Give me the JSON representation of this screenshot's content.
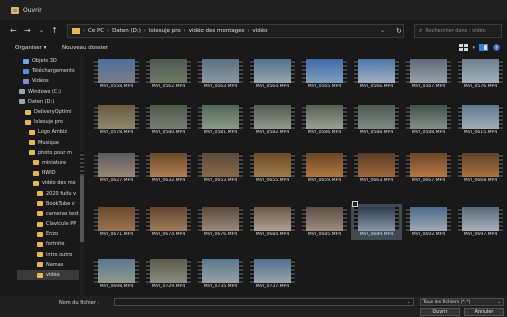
{
  "window": {
    "title": "Ouvrir"
  },
  "nav": {
    "back": "←",
    "forward": "→",
    "dropdown": "⌄",
    "up": "↑",
    "refresh": "↻"
  },
  "address": {
    "crumbs": [
      "Ce PC",
      "Daten (D:)",
      "lolesuje pro",
      "vidéo des montages",
      "vidéo"
    ]
  },
  "search": {
    "placeholder": "Rechercher dans : vidéo"
  },
  "commands": {
    "organize": "Organiser ▾",
    "new_folder": "Nouveau dossier"
  },
  "sidebar": {
    "items": [
      {
        "label": "Objets 3D",
        "icon": "cube-icon",
        "color": "#6aa9e6"
      },
      {
        "label": "Téléchargements",
        "icon": "download-icon",
        "color": "#4e8fe0"
      },
      {
        "label": "Vidéos",
        "icon": "video-icon",
        "color": "#8a8ad8"
      },
      {
        "label": "Windows (C:)",
        "icon": "drive-icon",
        "color": "#9aa6b2"
      },
      {
        "label": "Daten (D:)",
        "icon": "drive-icon",
        "color": "#9aa6b2"
      },
      {
        "label": "DeliveryOptimi",
        "icon": "folder-icon",
        "color": "#e8b84a"
      },
      {
        "label": "lolesuje pro",
        "icon": "folder-icon",
        "color": "#e8b84a"
      },
      {
        "label": "Logo Ambiz",
        "icon": "folder-icon",
        "color": "#e8b84a"
      },
      {
        "label": "Musique",
        "icon": "folder-icon",
        "color": "#e8b84a"
      },
      {
        "label": "photo pour m",
        "icon": "folder-icon",
        "color": "#e8b84a"
      },
      {
        "label": "miniature",
        "icon": "folder-icon",
        "color": "#e8b84a"
      },
      {
        "label": "RWID",
        "icon": "folder-icon",
        "color": "#e8b84a"
      },
      {
        "label": "vidéo des mo",
        "icon": "folder-icon",
        "color": "#e8b84a"
      },
      {
        "label": "2020 fuifu v",
        "icon": "folder-icon",
        "color": "#e8b84a"
      },
      {
        "label": "BookTube v",
        "icon": "folder-icon",
        "color": "#e8b84a"
      },
      {
        "label": "cameras test",
        "icon": "folder-icon",
        "color": "#e8b84a"
      },
      {
        "label": "Clavicule PP",
        "icon": "folder-icon",
        "color": "#e8b84a"
      },
      {
        "label": "Enzo",
        "icon": "folder-icon",
        "color": "#e8b84a"
      },
      {
        "label": "fortnite",
        "icon": "folder-icon",
        "color": "#e8b84a"
      },
      {
        "label": "intro outro",
        "icon": "folder-icon",
        "color": "#e8b84a"
      },
      {
        "label": "Namas",
        "icon": "folder-icon",
        "color": "#e8b84a"
      },
      {
        "label": "vidéo",
        "icon": "folder-icon",
        "color": "#e8b84a"
      }
    ]
  },
  "files": [
    {
      "name": "MVI_0558.MP4",
      "colors": [
        "#4a6f9a",
        "#7a7f86"
      ]
    },
    {
      "name": "MVI_0562.MP4",
      "colors": [
        "#4e5a52",
        "#6e7a62"
      ]
    },
    {
      "name": "MVI_0563.MP4",
      "colors": [
        "#5a6f82",
        "#8e99a0"
      ]
    },
    {
      "name": "MVI_0564.MP4",
      "colors": [
        "#54708e",
        "#9aa7ae"
      ]
    },
    {
      "name": "MVI_0565.MP4",
      "colors": [
        "#3f6aa5",
        "#80a0c0"
      ]
    },
    {
      "name": "MVI_0566.MP4",
      "colors": [
        "#4c78a8",
        "#a0b0c0"
      ]
    },
    {
      "name": "MVI_0567.MP4",
      "colors": [
        "#5c6a78",
        "#9aa2a8"
      ]
    },
    {
      "name": "MVI_0576.MP4",
      "colors": [
        "#6a7f92",
        "#a8b2ba"
      ]
    },
    {
      "name": "MVI_0578.MP4",
      "colors": [
        "#6a5a3a",
        "#8a8a70"
      ]
    },
    {
      "name": "MVI_0580.MP4",
      "colors": [
        "#4c5a48",
        "#7a7e76"
      ]
    },
    {
      "name": "MVI_0581.MP4",
      "colors": [
        "#4f6850",
        "#8c9a8a"
      ]
    },
    {
      "name": "MVI_0582.MP4",
      "colors": [
        "#4f5e4a",
        "#909a8e"
      ]
    },
    {
      "name": "MVI_0586.MP4",
      "colors": [
        "#55624e",
        "#9aa096"
      ]
    },
    {
      "name": "MVI_0588.MP4",
      "colors": [
        "#4a5c52",
        "#7e8a84"
      ]
    },
    {
      "name": "MVI_0588.MP4",
      "colors": [
        "#3e5248",
        "#86908a"
      ]
    },
    {
      "name": "MVI_0615.MP4",
      "colors": [
        "#5a7a90",
        "#a4aeb4"
      ]
    },
    {
      "name": "MVI_0627.MP4",
      "colors": [
        "#5a5a5e",
        "#9a8a76"
      ]
    },
    {
      "name": "MVI_0632.MP4",
      "colors": [
        "#6a4a2a",
        "#b08050"
      ]
    },
    {
      "name": "MVI_0653.MP4",
      "colors": [
        "#5a4a3a",
        "#8a6a48"
      ]
    },
    {
      "name": "MVI_0655.MP4",
      "colors": [
        "#6a4a2a",
        "#a07a4a"
      ]
    },
    {
      "name": "MVI_0659.MP4",
      "colors": [
        "#6a4424",
        "#b0783e"
      ]
    },
    {
      "name": "MVI_0663.MP4",
      "colors": [
        "#5a3a22",
        "#a06a3a"
      ]
    },
    {
      "name": "MVI_0667.MP4",
      "colors": [
        "#6a4526",
        "#b57a44"
      ]
    },
    {
      "name": "MVI_0668.MP4",
      "colors": [
        "#5c4226",
        "#a8743e"
      ]
    },
    {
      "name": "MVI_0671.MP4",
      "colors": [
        "#6a4a2e",
        "#9a7250"
      ]
    },
    {
      "name": "MVI_0674.MP4",
      "colors": [
        "#5e4632",
        "#a07c58"
      ]
    },
    {
      "name": "MVI_0676.MP4",
      "colors": [
        "#5a4a3e",
        "#9a8a76"
      ]
    },
    {
      "name": "MVI_0684.MP4",
      "colors": [
        "#6a5a4a",
        "#b0a090"
      ]
    },
    {
      "name": "MVI_0685.MP4",
      "colors": [
        "#5a4e44",
        "#a08e7c"
      ]
    },
    {
      "name": "MVI_0689.MP4",
      "colors": [
        "#2e3e4e",
        "#8a98a8"
      ],
      "selected": true
    },
    {
      "name": "MVI_0692.MP4",
      "colors": [
        "#4a6a8a",
        "#a0aab4"
      ]
    },
    {
      "name": "MVI_0697.MP4",
      "colors": [
        "#5a6a7a",
        "#a8b0b8"
      ]
    },
    {
      "name": "MVI_0698.MP4",
      "colors": [
        "#5a7894",
        "#8e9a8a"
      ]
    },
    {
      "name": "MVI_0729.MP4",
      "colors": [
        "#5c5a4a",
        "#8a8e80"
      ]
    },
    {
      "name": "MVI_0735.MP4",
      "colors": [
        "#5a7890",
        "#98a2a0"
      ]
    },
    {
      "name": "MVI_0737.MP4",
      "colors": [
        "#4f6e8e",
        "#9aa6aa"
      ]
    }
  ],
  "footer": {
    "filename_label": "Nom du fichier :",
    "filename_value": "",
    "filetype": "Tous les fichiers (*.*)",
    "open": "Ouvrir",
    "cancel": "Annuler"
  }
}
